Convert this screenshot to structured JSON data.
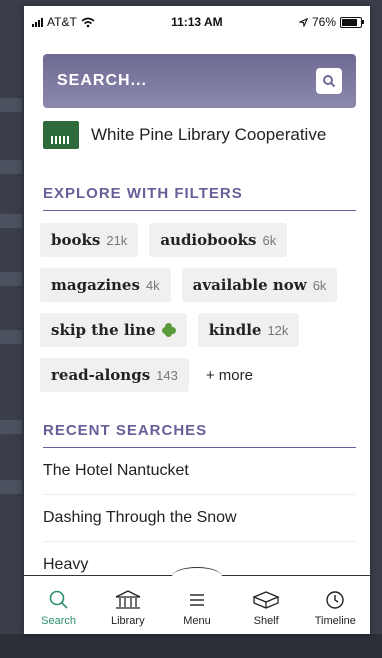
{
  "status": {
    "carrier": "AT&T",
    "time": "11:13 AM",
    "battery": "76%"
  },
  "search": {
    "placeholder": "SEARCH...",
    "icon": "search-icon"
  },
  "library": {
    "name": "White Pine Library Cooperative"
  },
  "explore": {
    "title": "EXPLORE WITH FILTERS",
    "chips": [
      {
        "label": "books",
        "count": "21k"
      },
      {
        "label": "audiobooks",
        "count": "6k"
      },
      {
        "label": "magazines",
        "count": "4k"
      },
      {
        "label": "available now",
        "count": "6k"
      },
      {
        "label": "skip the line",
        "icon": "clover-icon"
      },
      {
        "label": "kindle",
        "count": "12k"
      },
      {
        "label": "read-alongs",
        "count": "143"
      },
      {
        "label": "+ more"
      }
    ]
  },
  "recent": {
    "title": "RECENT SEARCHES",
    "items": [
      "The Hotel Nantucket",
      "Dashing Through the Snow",
      "Heavy"
    ]
  },
  "tabs": [
    {
      "label": "Search",
      "icon": "search-icon",
      "active": true
    },
    {
      "label": "Library",
      "icon": "library-icon"
    },
    {
      "label": "Menu",
      "icon": "menu-icon"
    },
    {
      "label": "Shelf",
      "icon": "shelf-icon"
    },
    {
      "label": "Timeline",
      "icon": "timeline-icon"
    }
  ],
  "colors": {
    "accent": "#6a5e98",
    "active_tab": "#2c8f6c",
    "search_gradient_top": "#6e6a93"
  }
}
